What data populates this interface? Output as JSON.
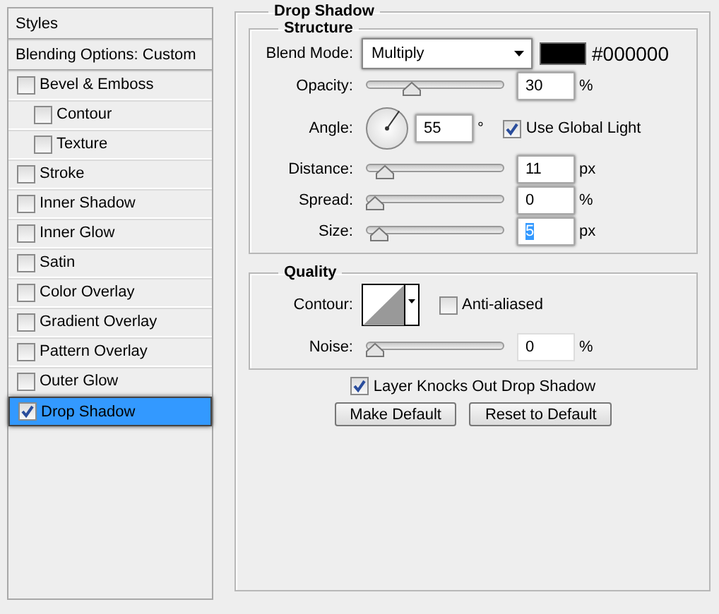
{
  "sidebar": {
    "items": [
      {
        "kind": "header",
        "label": "Styles",
        "selected": false
      },
      {
        "kind": "header",
        "label": "Blending Options: Custom",
        "selected": false
      },
      {
        "kind": "effect",
        "label": "Bevel & Emboss",
        "checked": false,
        "selected": false,
        "children": [
          {
            "kind": "effect",
            "label": "Contour",
            "checked": false,
            "selected": false
          },
          {
            "kind": "effect",
            "label": "Texture",
            "checked": false,
            "selected": false
          }
        ]
      },
      {
        "kind": "effect",
        "label": "Stroke",
        "checked": false,
        "selected": false
      },
      {
        "kind": "effect",
        "label": "Inner Shadow",
        "checked": false,
        "selected": false
      },
      {
        "kind": "effect",
        "label": "Inner Glow",
        "checked": false,
        "selected": false
      },
      {
        "kind": "effect",
        "label": "Satin",
        "checked": false,
        "selected": false
      },
      {
        "kind": "effect",
        "label": "Color Overlay",
        "checked": false,
        "selected": false
      },
      {
        "kind": "effect",
        "label": "Gradient Overlay",
        "checked": false,
        "selected": false
      },
      {
        "kind": "effect",
        "label": "Pattern Overlay",
        "checked": false,
        "selected": false
      },
      {
        "kind": "effect",
        "label": "Outer Glow",
        "checked": false,
        "selected": false
      },
      {
        "kind": "effect",
        "label": "Drop Shadow",
        "checked": true,
        "selected": true
      }
    ]
  },
  "panel": {
    "title": "Drop Shadow",
    "groups": [
      {
        "title": "Structure",
        "rows": [
          {
            "kind": "select",
            "label": "Blend Mode:",
            "value": "Multiply",
            "color": "#000000",
            "hex": "#000000"
          },
          {
            "kind": "slider",
            "label": "Opacity:",
            "level": 0.3,
            "value": "30",
            "unit": "%",
            "selected": false
          },
          {
            "kind": "dial",
            "label": "Angle:",
            "value": "55",
            "unit": "°",
            "checkbox": {
              "label": "Use Global Light",
              "checked": true
            }
          },
          {
            "kind": "slider",
            "label": "Distance:",
            "level": 0.08,
            "value": "11",
            "unit": "px",
            "selected": false
          },
          {
            "kind": "slider",
            "label": "Spread:",
            "level": 0,
            "value": "0",
            "unit": "%",
            "selected": false
          },
          {
            "kind": "slider",
            "label": "Size:",
            "level": 0.03,
            "value": "5",
            "unit": "px",
            "selected": true
          }
        ]
      },
      {
        "title": "Quality",
        "rows": [
          {
            "kind": "contour",
            "label": "Contour:",
            "checkbox": {
              "label": "Anti-aliased",
              "checked": false
            }
          },
          {
            "kind": "slider",
            "label": "Noise:",
            "level": 0,
            "value": "0",
            "unit": "%",
            "selected": false
          }
        ]
      }
    ],
    "knockout": {
      "label": "Layer Knocks Out Drop Shadow",
      "checked": true
    },
    "buttons": [
      "Make Default",
      "Reset to Default"
    ]
  }
}
